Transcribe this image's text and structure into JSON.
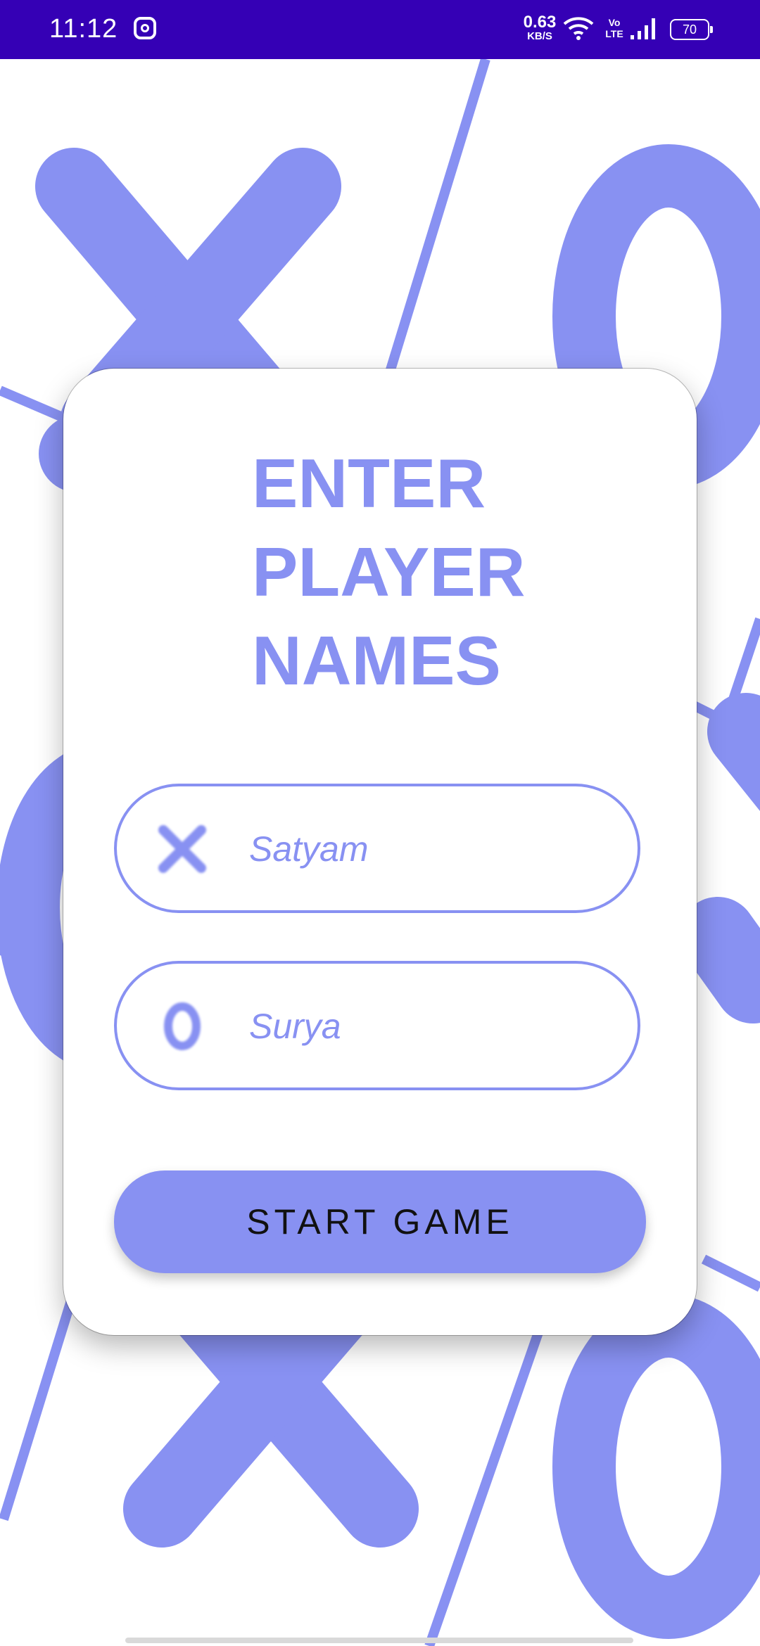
{
  "status_bar": {
    "time": "11:12",
    "net_speed_value": "0.63",
    "net_speed_unit": "KB/S",
    "volte_top": "Vo",
    "volte_bottom": "LTE",
    "battery": "70",
    "icons": [
      "instagram-icon",
      "wifi-icon",
      "volte-icon",
      "signal-icon",
      "battery-icon"
    ]
  },
  "card": {
    "title_line1": "ENTER",
    "title_line2": "PLAYER",
    "title_line3": "NAMES",
    "player1": {
      "mark": "X",
      "value": "Satyam",
      "icon": "x-mark-icon"
    },
    "player2": {
      "mark": "O",
      "value": "Surya",
      "icon": "o-mark-icon"
    },
    "start_label": "START GAME"
  },
  "colors": {
    "accent": "#8891f2",
    "status_bar": "#3500b5",
    "background": "#ffffff"
  }
}
